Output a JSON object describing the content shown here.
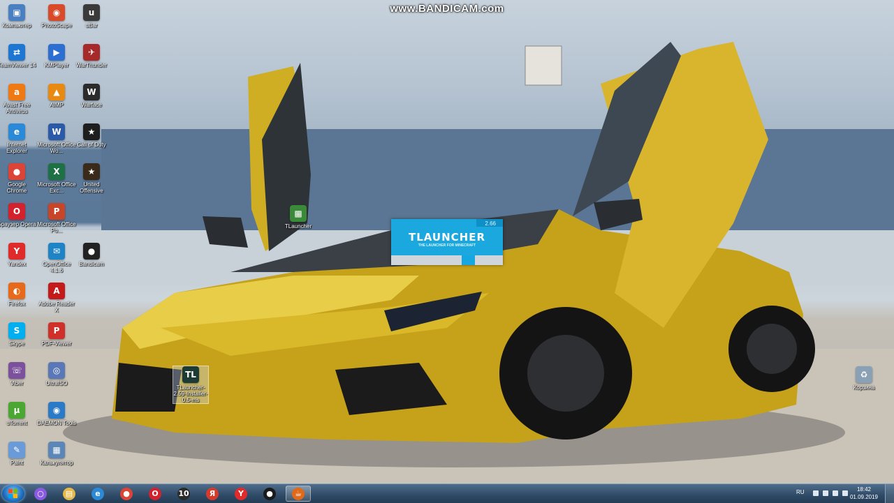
{
  "watermark": "www.BANDICAM.com",
  "desktop_icons": [
    {
      "label": "Компьютер",
      "icon": "computer-icon",
      "color": "#4a7fc1",
      "glyph": "▣"
    },
    {
      "label": "PhotoScape",
      "icon": "photoscape-icon",
      "color": "#d94a2b",
      "glyph": "◉"
    },
    {
      "label": "uBar",
      "icon": "ubar-icon",
      "color": "#3a3a3a",
      "glyph": "u"
    },
    {
      "label": "TeamViewer 14",
      "icon": "teamviewer-icon",
      "color": "#1c76d2",
      "glyph": "⇄"
    },
    {
      "label": "KMPlayer",
      "icon": "kmplayer-icon",
      "color": "#2a6fd1",
      "glyph": "▶"
    },
    {
      "label": "WarThunder",
      "icon": "warthunder-icon",
      "color": "#a62a2a",
      "glyph": "✈"
    },
    {
      "label": "Avast Free Antivirus",
      "icon": "avast-icon",
      "color": "#ef7a14",
      "glyph": "a"
    },
    {
      "label": "AIMP",
      "icon": "aimp-icon",
      "color": "#e88a12",
      "glyph": "▲"
    },
    {
      "label": "Warface",
      "icon": "warface-icon",
      "color": "#2b2b2b",
      "glyph": "W"
    },
    {
      "label": "Internet Explorer",
      "icon": "internet-explorer-icon",
      "color": "#2a8ad8",
      "glyph": "e"
    },
    {
      "label": "Microsoft Office Wo...",
      "icon": "word-icon",
      "color": "#2a5aa8",
      "glyph": "W"
    },
    {
      "label": "Call of Duty",
      "icon": "call-of-duty-icon",
      "color": "#1e1e1e",
      "glyph": "★"
    },
    {
      "label": "Google Chrome",
      "icon": "chrome-icon",
      "color": "#db4437",
      "glyph": "●"
    },
    {
      "label": "Microsoft Office Exc...",
      "icon": "excel-icon",
      "color": "#1e7145",
      "glyph": "X"
    },
    {
      "label": "United Offensive",
      "icon": "united-offensive-icon",
      "color": "#3a2a1a",
      "glyph": "★"
    },
    {
      "label": "Браузер Opera",
      "icon": "opera-icon",
      "color": "#d3212d",
      "glyph": "O"
    },
    {
      "label": "Microsoft Office Po...",
      "icon": "powerpoint-icon",
      "color": "#c8452a",
      "glyph": "P"
    },
    {
      "label": "Yandex",
      "icon": "yandex-icon",
      "color": "#e02b2b",
      "glyph": "Y"
    },
    {
      "label": "OpenOffice 4.1.6",
      "icon": "openoffice-icon",
      "color": "#1f84c6",
      "glyph": "✉"
    },
    {
      "label": "Bandicam",
      "icon": "bandicam-icon",
      "color": "#222222",
      "glyph": "●"
    },
    {
      "label": "Firefox",
      "icon": "firefox-icon",
      "color": "#e66a1a",
      "glyph": "◐"
    },
    {
      "label": "Adobe Reader X",
      "icon": "adobe-reader-icon",
      "color": "#c41a1a",
      "glyph": "A"
    },
    {
      "label": "Skype",
      "icon": "skype-icon",
      "color": "#00aff0",
      "glyph": "S"
    },
    {
      "label": "PDF-Viewer",
      "icon": "pdf-viewer-icon",
      "color": "#d0302a",
      "glyph": "P"
    },
    {
      "label": "Viber",
      "icon": "viber-icon",
      "color": "#7b519d",
      "glyph": "☏"
    },
    {
      "label": "UltraISO",
      "icon": "ultraiso-icon",
      "color": "#5a78b8",
      "glyph": "◎"
    },
    {
      "label": "uTorrent",
      "icon": "utorrent-icon",
      "color": "#4aa832",
      "glyph": "μ"
    },
    {
      "label": "DAEMON Tools",
      "icon": "daemon-tools-icon",
      "color": "#2a7ac8",
      "glyph": "◉"
    },
    {
      "label": "Paint",
      "icon": "paint-icon",
      "color": "#6a9ad8",
      "glyph": "✎"
    },
    {
      "label": "Калькулятор",
      "icon": "calculator-icon",
      "color": "#5a86b8",
      "glyph": "▦"
    },
    {
      "label": "TLauncher",
      "icon": "tlauncher-icon",
      "color": "#3a8a3a",
      "glyph": "▩"
    },
    {
      "label": "TLauncher-2.59-Installer-0.5-ms",
      "icon": "tlauncher-installer-icon",
      "color": "#1d3b35",
      "glyph": "TL"
    },
    {
      "label": "Корзина",
      "icon": "recycle-bin-icon",
      "color": "#8aa0b4",
      "glyph": "♻"
    }
  ],
  "splash": {
    "title": "TLAUNCHER",
    "subtitle": "THE LAUNCHER FOR MINECRAFT",
    "version": "2.66",
    "progress": 0.12,
    "color": "#1aa8df"
  },
  "taskbar": {
    "start_label": "Start",
    "pinned": [
      {
        "name": "cortana-icon",
        "color": "#8a5ae0",
        "glyph": "○"
      },
      {
        "name": "file-explorer-icon",
        "color": "#e5b84a",
        "glyph": "▤"
      },
      {
        "name": "internet-explorer-icon",
        "color": "#2a8ad8",
        "glyph": "e"
      },
      {
        "name": "chrome-icon",
        "color": "#db4437",
        "glyph": "●"
      },
      {
        "name": "opera-icon",
        "color": "#d3212d",
        "glyph": "O"
      },
      {
        "name": "app-10-icon",
        "color": "#2b2b2b",
        "glyph": "10"
      },
      {
        "name": "yandex-browser-icon",
        "color": "#d83a2a",
        "glyph": "Я"
      },
      {
        "name": "yandex-icon",
        "color": "#e02b2b",
        "glyph": "Y"
      },
      {
        "name": "bandicam-icon",
        "color": "#1a1a1a",
        "glyph": "●"
      },
      {
        "name": "java-icon",
        "color": "#e06a1a",
        "glyph": "☕"
      }
    ],
    "active_index": 9,
    "language": "RU",
    "time": "18:42",
    "date": "01.09.2019"
  }
}
